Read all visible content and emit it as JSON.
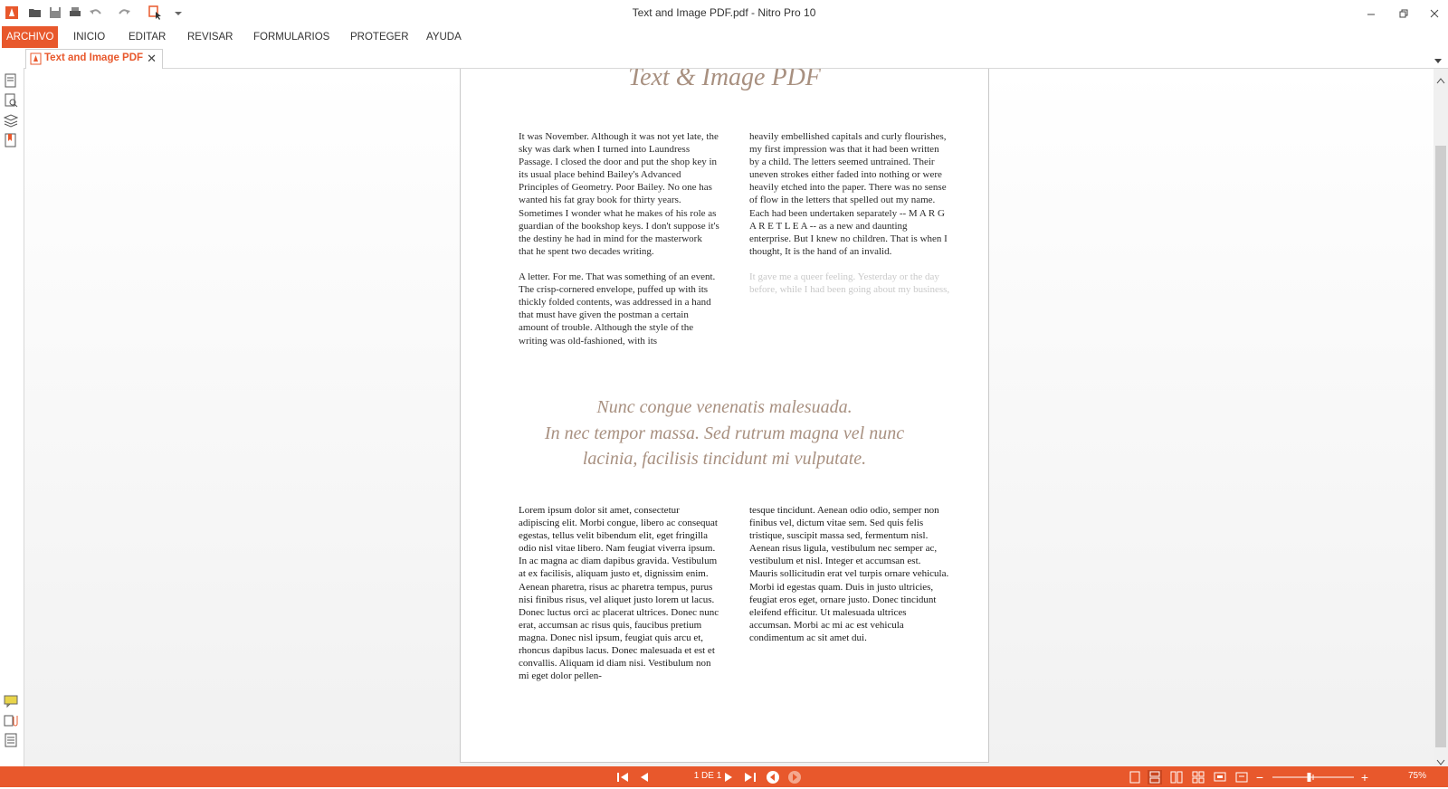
{
  "window": {
    "title": "Text and Image PDF.pdf - Nitro Pro 10"
  },
  "ribbon": {
    "tabs": [
      {
        "label": "ARCHIVO"
      },
      {
        "label": "INICIO"
      },
      {
        "label": "EDITAR"
      },
      {
        "label": "REVISAR"
      },
      {
        "label": "FORMULARIOS"
      },
      {
        "label": "PROTEGER"
      },
      {
        "label": "AYUDA"
      }
    ],
    "active_tab": "ARCHIVO"
  },
  "document_tab": {
    "label": "Text and Image PDF"
  },
  "document": {
    "title": "Text & Image PDF",
    "column1_paragraphs": [
      "It was November. Although it was not yet late, the sky was dark when I turned into Laundress Passage. I closed the door and put the shop key in its usual place behind Bailey's Advanced Principles of Geometry. Poor Bailey. No one has wanted his fat gray book for thirty years. Sometimes I wonder what he makes of his role as guardian of the bookshop keys. I don't suppose it's the destiny he had in mind for the masterwork that he spent two decades writing.",
      "A letter. For me. That was something of an event. The crisp-cornered envelope, puffed up with its thickly folded contents, was addressed in a hand that must have given the postman a certain amount of trouble. Although the style of the writing was old-fashioned, with its"
    ],
    "column2_paragraphs": [
      "heavily embellished capitals and curly flourishes, my first impression was that it had been written by a child. The letters seemed untrained. Their uneven strokes either faded into nothing or were heavily etched into the paper. There was no sense of flow in the letters that spelled out my name. Each had been undertaken separately -- M A R G A R E T L E A -- as a new and daunting enterprise. But I knew no children. That is when I thought, It is the hand of an invalid."
    ],
    "column2_faded": "It gave me a queer feeling. Yesterday or the day before, while I had been going about my business, quietly and in private, some",
    "quote_lines": [
      "Nunc congue venenatis malesuada.",
      "In nec tempor massa. Sed rutrum magna vel nunc",
      "lacinia, facilisis tincidunt mi vulputate."
    ],
    "lorem_col1": "Lorem ipsum dolor sit amet, consectetur adipiscing elit. Morbi congue, libero ac consequat egestas, tellus velit bibendum elit, eget fringilla odio nisl vitae libero. Nam feugiat viverra ipsum. In ac magna ac diam dapibus gravida. Vestibulum at ex facilisis, aliquam justo et, dignissim enim. Aenean pharetra, risus ac pharetra tempus, purus nisi finibus risus, vel aliquet justo lorem ut lacus. Donec luctus orci ac placerat ultrices. Donec nunc erat, accumsan ac risus quis, faucibus pretium magna. Donec nisl ipsum, feugiat quis arcu et, rhoncus dapibus lacus. Donec malesuada et est et convallis. Aliquam id diam nisi. Vestibulum non mi eget dolor pellen-",
    "lorem_col2_a": "tesque tincidunt. Aenean odio odio, semper non finibus vel, dictum vitae sem. Sed quis felis tristique, suscipit massa sed, fermentum nisl.",
    "lorem_col2_b": "Aenean risus ligula, vestibulum nec semper ac, vestibulum et nisl. Integer et accumsan est. Mauris sollicitudin erat vel turpis ornare vehicula. Morbi id egestas quam. Duis in justo ultricies, feugiat eros eget, ornare justo. Donec tincidunt eleifend efficitur. Ut malesuada ultrices accumsan. Morbi ac mi ac est vehicula condimentum ac sit amet dui."
  },
  "status": {
    "page_indicator": "1 DE 1",
    "zoom": "75%",
    "zoom_level": 0.45
  },
  "colors": {
    "accent": "#e8582c",
    "heading": "#a89080"
  }
}
